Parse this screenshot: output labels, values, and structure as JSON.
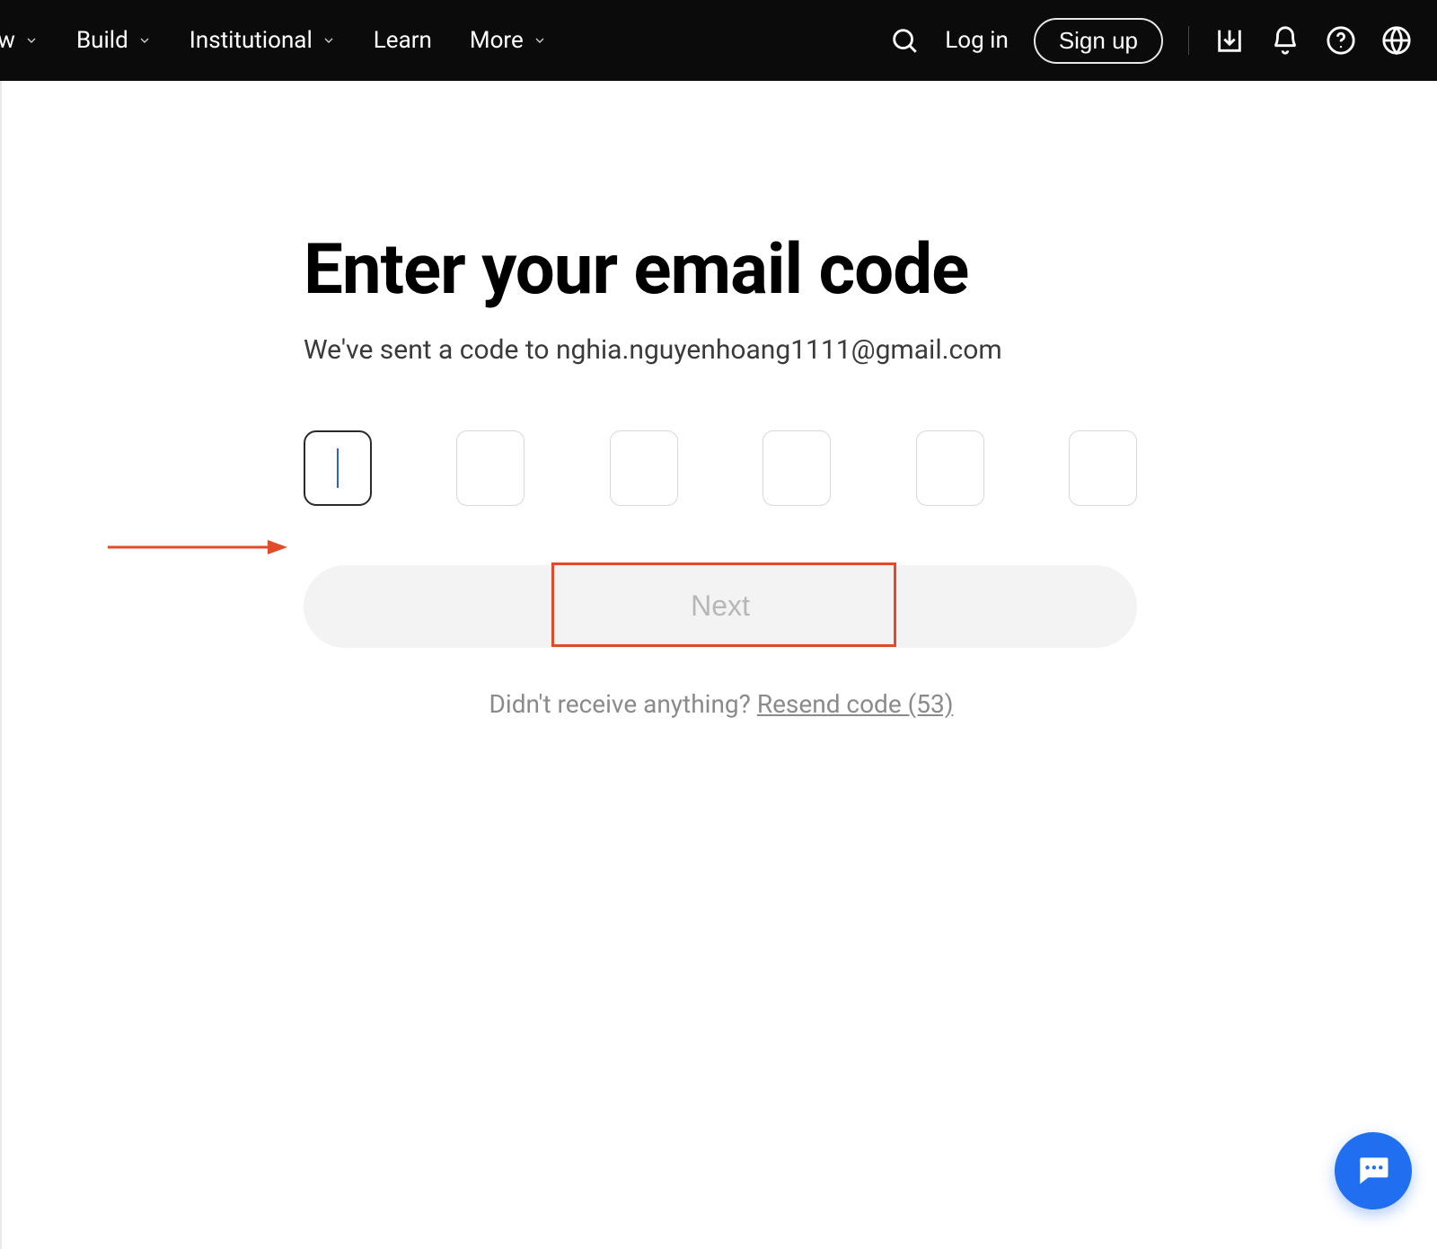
{
  "header": {
    "nav": {
      "item_row_partial": "row",
      "item_build": "Build",
      "item_institutional": "Institutional",
      "item_learn": "Learn",
      "item_more": "More"
    },
    "login_label": "Log in",
    "signup_label": "Sign up"
  },
  "main": {
    "title": "Enter your email code",
    "subtitle_prefix": "We've sent a code to ",
    "email": "nghia.nguyenhoang1111@gmail.com",
    "next_label": "Next",
    "resend_prefix": "Didn't receive anything?",
    "resend_link_label": " Resend code ",
    "resend_countdown": "(53)"
  }
}
